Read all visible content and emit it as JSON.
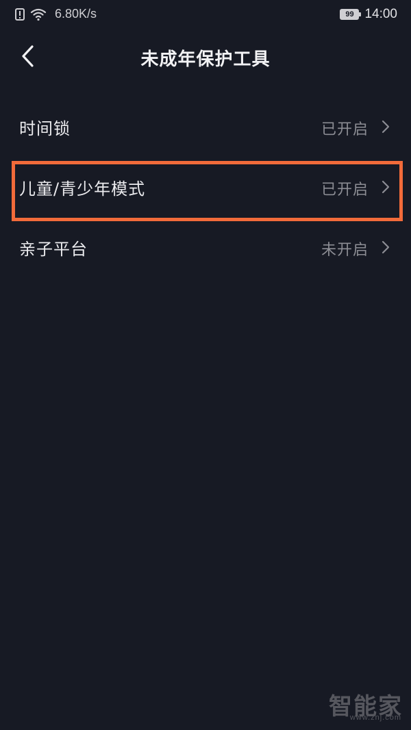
{
  "status_bar": {
    "alert_icon": "sim-alert-icon",
    "wifi_icon": "wifi-icon",
    "speed": "6.80K/s",
    "battery_level": "99",
    "time": "14:00"
  },
  "header": {
    "back_icon": "chevron-left-icon",
    "title": "未成年保护工具"
  },
  "list": {
    "items": [
      {
        "label": "时间锁",
        "status": "已开启"
      },
      {
        "label": "儿童/青少年模式",
        "status": "已开启",
        "highlighted": true
      },
      {
        "label": "亲子平台",
        "status": "未开启"
      }
    ]
  },
  "annotation": {
    "highlight_color": "#f26b3a"
  },
  "watermark": {
    "brand": "智能家",
    "url": "www.znj.com"
  },
  "colors": {
    "background": "#171a24",
    "text_primary": "#ebebee",
    "text_secondary": "#8c8d94"
  }
}
